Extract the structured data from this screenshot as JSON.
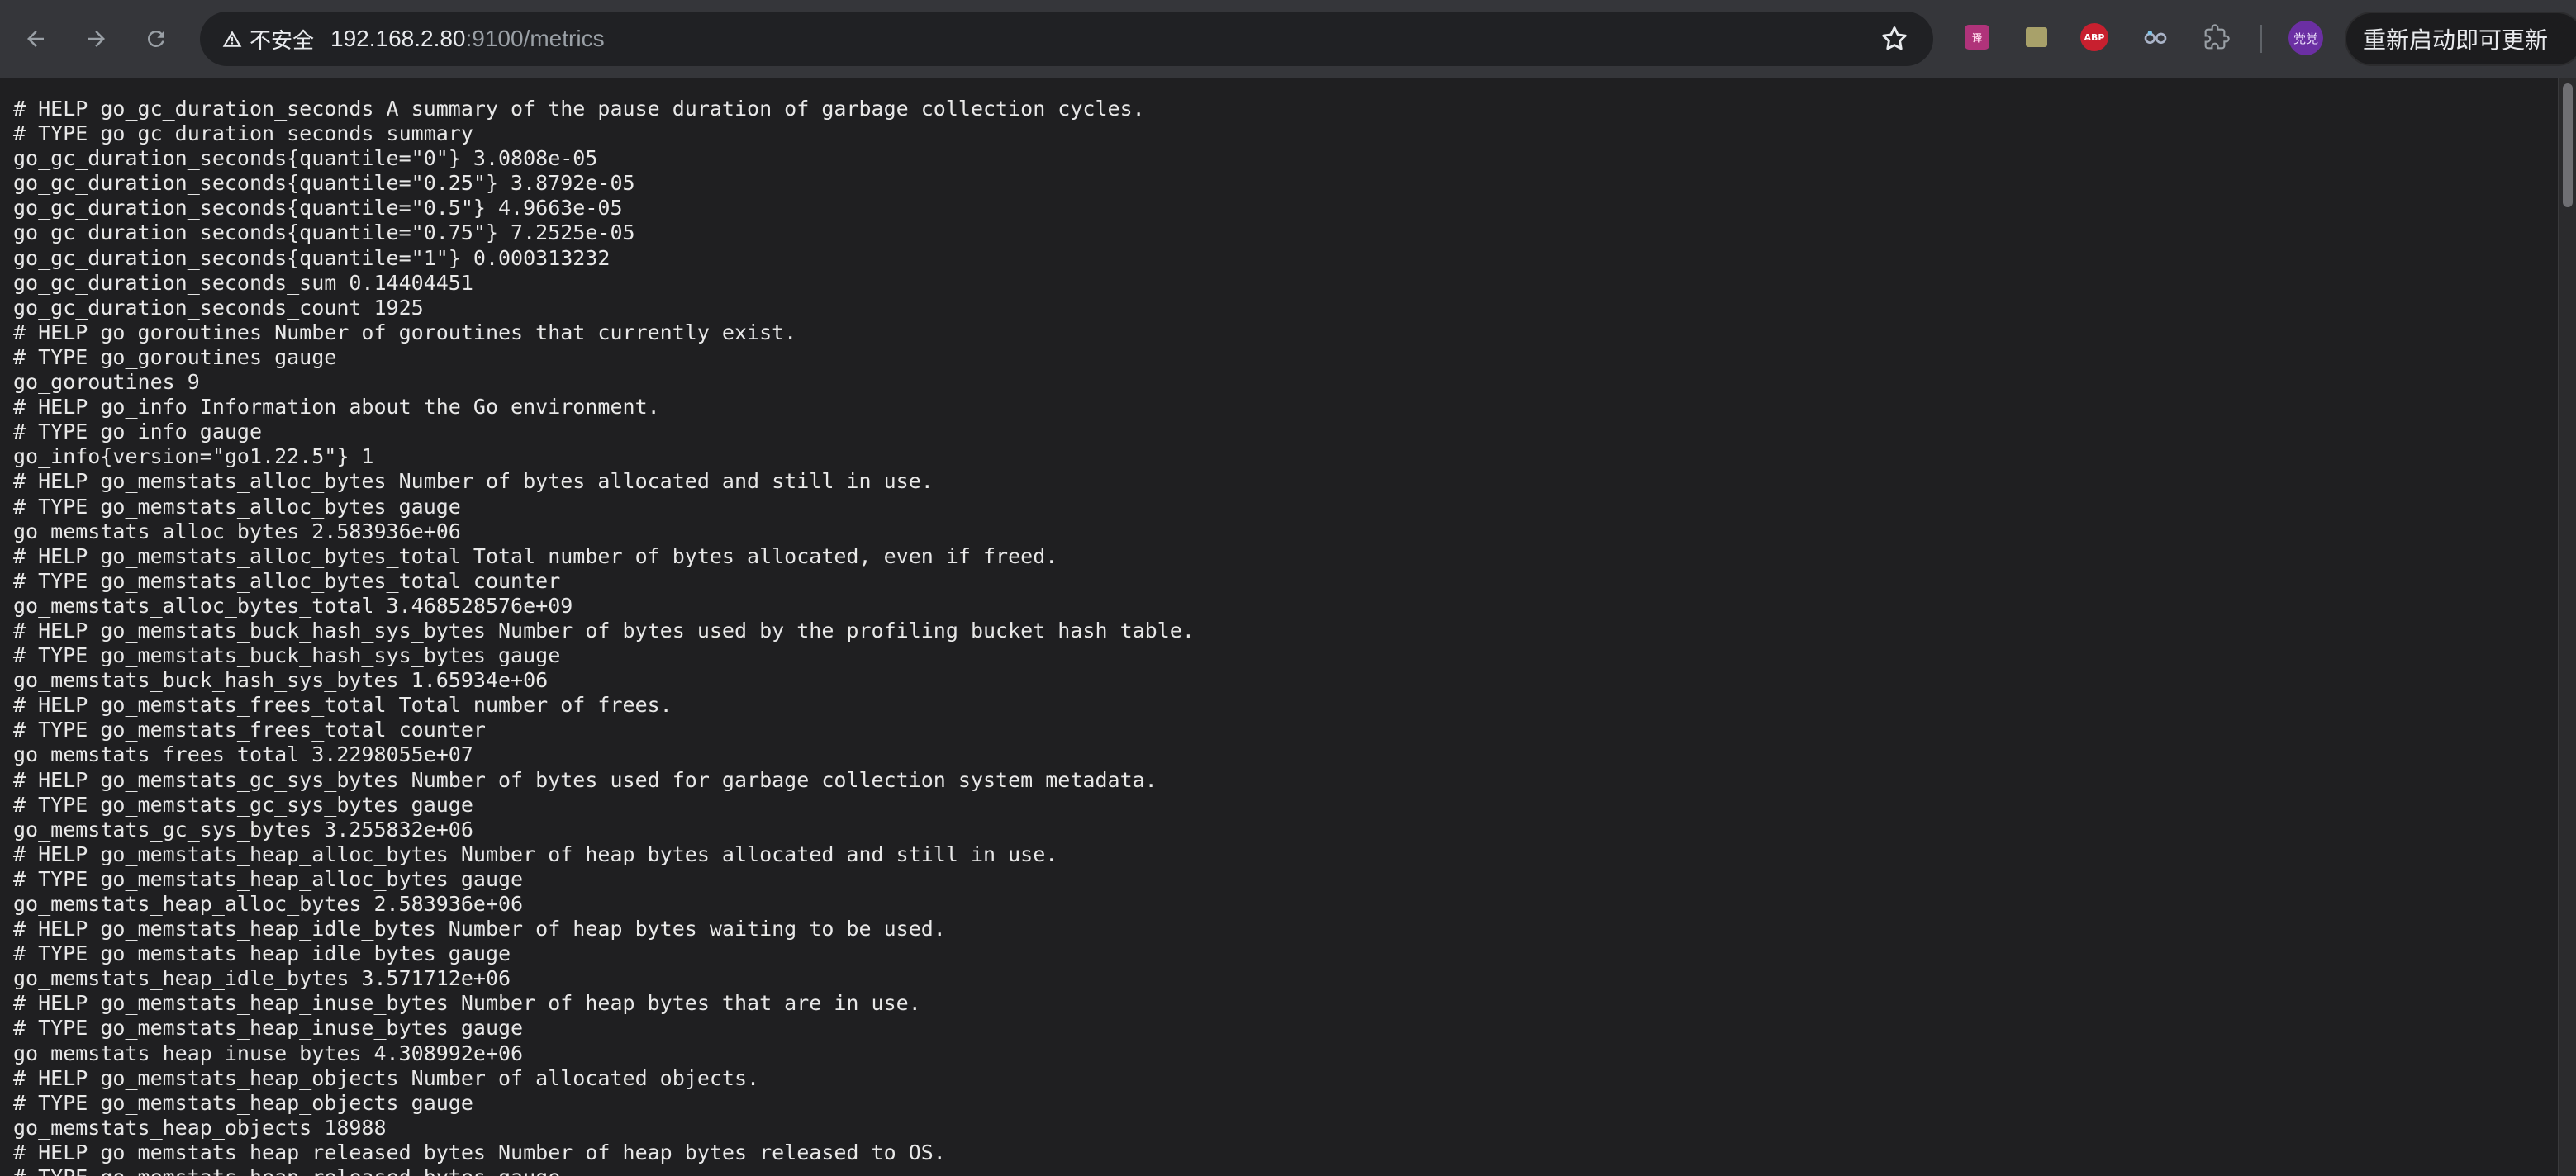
{
  "toolbar": {
    "security_label": "不安全",
    "url_host": "192.168.2.80",
    "url_rest": ":9100/metrics",
    "update_label": "重新启动即可更新",
    "avatar_label": "党党",
    "icons": [
      "back-icon",
      "forward-icon",
      "reload-icon",
      "warning-icon",
      "star-icon",
      "translate-extension-icon",
      "notes-extension-icon",
      "adblock-extension-icon",
      "reader-extension-icon",
      "puzzle-icon",
      "avatar"
    ],
    "ext_abp_label": "ABP"
  },
  "page": {
    "lines": [
      "# HELP go_gc_duration_seconds A summary of the pause duration of garbage collection cycles.",
      "# TYPE go_gc_duration_seconds summary",
      "go_gc_duration_seconds{quantile=\"0\"} 3.0808e-05",
      "go_gc_duration_seconds{quantile=\"0.25\"} 3.8792e-05",
      "go_gc_duration_seconds{quantile=\"0.5\"} 4.9663e-05",
      "go_gc_duration_seconds{quantile=\"0.75\"} 7.2525e-05",
      "go_gc_duration_seconds{quantile=\"1\"} 0.000313232",
      "go_gc_duration_seconds_sum 0.14404451",
      "go_gc_duration_seconds_count 1925",
      "# HELP go_goroutines Number of goroutines that currently exist.",
      "# TYPE go_goroutines gauge",
      "go_goroutines 9",
      "# HELP go_info Information about the Go environment.",
      "# TYPE go_info gauge",
      "go_info{version=\"go1.22.5\"} 1",
      "# HELP go_memstats_alloc_bytes Number of bytes allocated and still in use.",
      "# TYPE go_memstats_alloc_bytes gauge",
      "go_memstats_alloc_bytes 2.583936e+06",
      "# HELP go_memstats_alloc_bytes_total Total number of bytes allocated, even if freed.",
      "# TYPE go_memstats_alloc_bytes_total counter",
      "go_memstats_alloc_bytes_total 3.468528576e+09",
      "# HELP go_memstats_buck_hash_sys_bytes Number of bytes used by the profiling bucket hash table.",
      "# TYPE go_memstats_buck_hash_sys_bytes gauge",
      "go_memstats_buck_hash_sys_bytes 1.65934e+06",
      "# HELP go_memstats_frees_total Total number of frees.",
      "# TYPE go_memstats_frees_total counter",
      "go_memstats_frees_total 3.2298055e+07",
      "# HELP go_memstats_gc_sys_bytes Number of bytes used for garbage collection system metadata.",
      "# TYPE go_memstats_gc_sys_bytes gauge",
      "go_memstats_gc_sys_bytes 3.255832e+06",
      "# HELP go_memstats_heap_alloc_bytes Number of heap bytes allocated and still in use.",
      "# TYPE go_memstats_heap_alloc_bytes gauge",
      "go_memstats_heap_alloc_bytes 2.583936e+06",
      "# HELP go_memstats_heap_idle_bytes Number of heap bytes waiting to be used.",
      "# TYPE go_memstats_heap_idle_bytes gauge",
      "go_memstats_heap_idle_bytes 3.571712e+06",
      "# HELP go_memstats_heap_inuse_bytes Number of heap bytes that are in use.",
      "# TYPE go_memstats_heap_inuse_bytes gauge",
      "go_memstats_heap_inuse_bytes 4.308992e+06",
      "# HELP go_memstats_heap_objects Number of allocated objects.",
      "# TYPE go_memstats_heap_objects gauge",
      "go_memstats_heap_objects 18988",
      "# HELP go_memstats_heap_released_bytes Number of heap bytes released to OS.",
      "# TYPE go_memstats_heap_released_bytes gauge"
    ]
  }
}
